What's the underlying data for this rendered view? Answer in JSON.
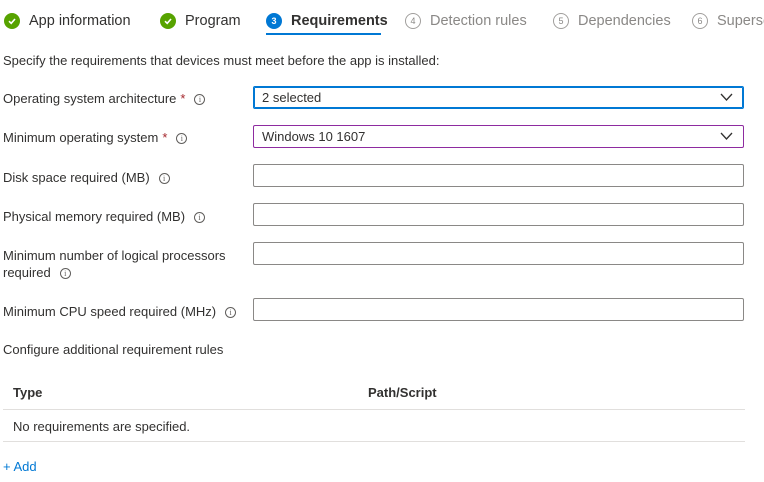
{
  "wizard": {
    "steps": [
      {
        "label": "App information",
        "number": "",
        "state": "complete"
      },
      {
        "label": "Program",
        "number": "",
        "state": "complete"
      },
      {
        "label": "Requirements",
        "number": "3",
        "state": "current"
      },
      {
        "label": "Detection rules",
        "number": "4",
        "state": "upcoming"
      },
      {
        "label": "Dependencies",
        "number": "5",
        "state": "upcoming"
      },
      {
        "label": "Supersedence",
        "number": "6",
        "state": "upcoming"
      }
    ]
  },
  "intro": "Specify the requirements that devices must meet before the app is installed:",
  "form": {
    "os_arch_label": "Operating system architecture",
    "os_arch_value": "2 selected",
    "min_os_label": "Minimum operating system",
    "min_os_value": "Windows 10 1607",
    "disk_label": "Disk space required (MB)",
    "disk_value": "",
    "memory_label": "Physical memory required (MB)",
    "memory_value": "",
    "processors_label": "Minimum number of logical processors required",
    "processors_value": "",
    "cpu_label": "Minimum CPU speed required (MHz)",
    "cpu_value": "",
    "required_mark": "*",
    "info_glyph": "i"
  },
  "rules": {
    "section_title": "Configure additional requirement rules",
    "columns": [
      "Type",
      "Path/Script"
    ],
    "empty_text": "No requirements are specified.",
    "add_label": "+ Add"
  },
  "colors": {
    "accent": "#0078d4",
    "complete": "#57a300",
    "required": "#a4262c",
    "dirty_border": "#8e2ba0"
  }
}
